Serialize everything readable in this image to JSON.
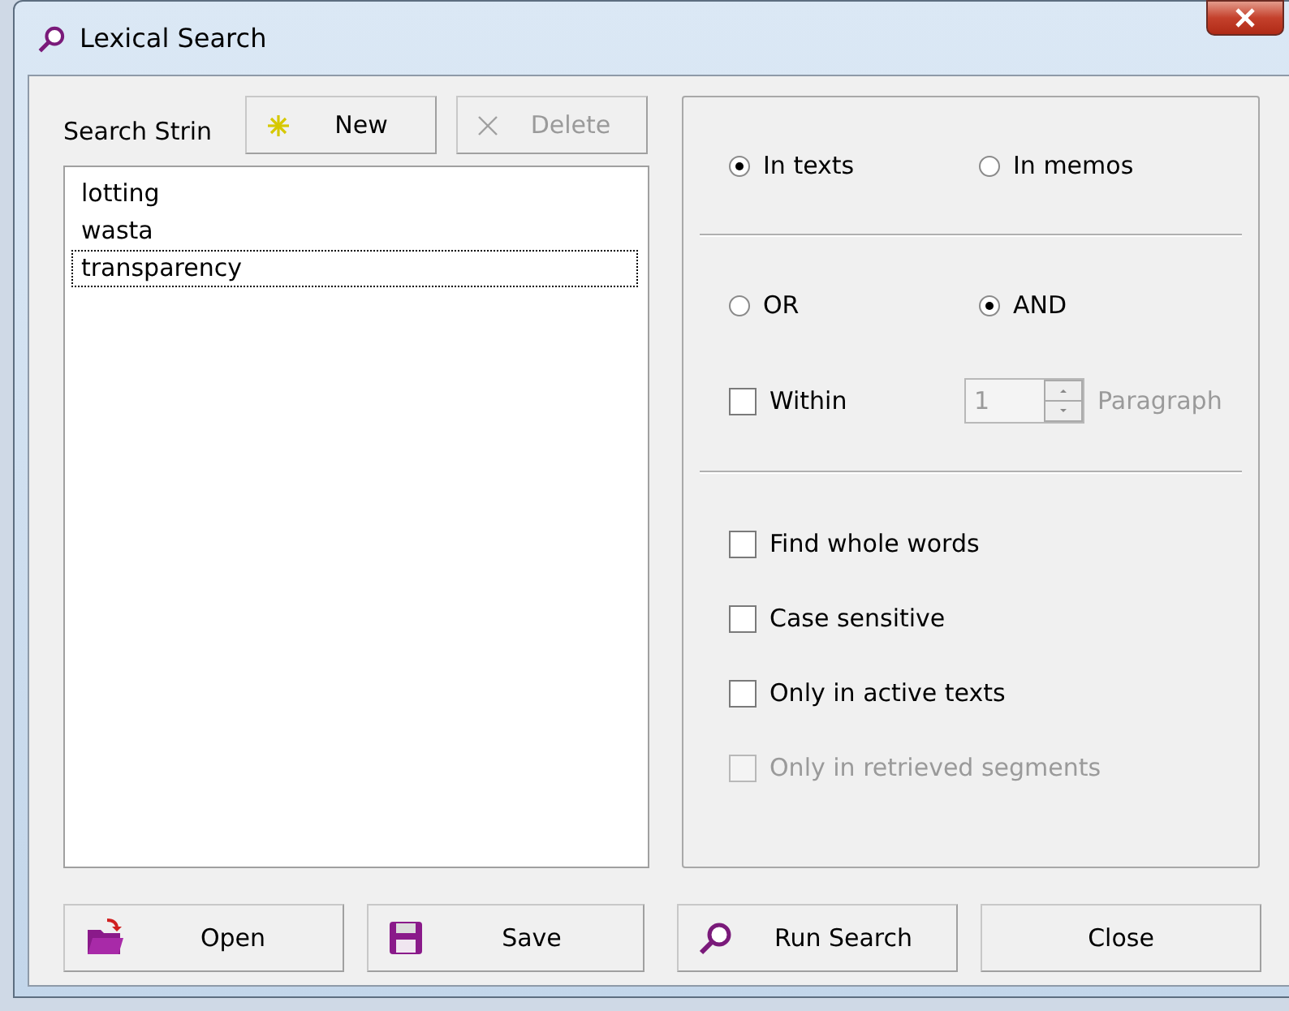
{
  "window": {
    "title": "Lexical Search"
  },
  "search_label": "Search Strin",
  "list_buttons": [
    {
      "kind": "new",
      "label": "New",
      "disabled": false
    },
    {
      "kind": "delete",
      "label": "Delete",
      "disabled": true
    }
  ],
  "search_strings": [
    {
      "text": "lotting",
      "selected": false
    },
    {
      "text": "wasta",
      "selected": false
    },
    {
      "text": "transparency",
      "selected": true
    }
  ],
  "scope": [
    {
      "label": "In texts",
      "selected": true
    },
    {
      "label": "In memos",
      "selected": false
    }
  ],
  "operator": [
    {
      "label": "OR",
      "selected": false
    },
    {
      "label": "AND",
      "selected": true
    }
  ],
  "within": {
    "label": "Within",
    "checked": false,
    "value": "1",
    "unit": "Paragraph",
    "disabled": true
  },
  "options": [
    {
      "label": "Find whole words",
      "checked": false,
      "disabled": false
    },
    {
      "label": "Case sensitive",
      "checked": false,
      "disabled": false
    },
    {
      "label": "Only in active texts",
      "checked": false,
      "disabled": false
    },
    {
      "label": "Only in retrieved segments",
      "checked": false,
      "disabled": true
    }
  ],
  "buttons": [
    {
      "kind": "open",
      "label": "Open"
    },
    {
      "kind": "save",
      "label": "Save"
    },
    {
      "kind": "search",
      "label": "Run Search"
    },
    {
      "kind": "close",
      "label": "Close"
    }
  ]
}
